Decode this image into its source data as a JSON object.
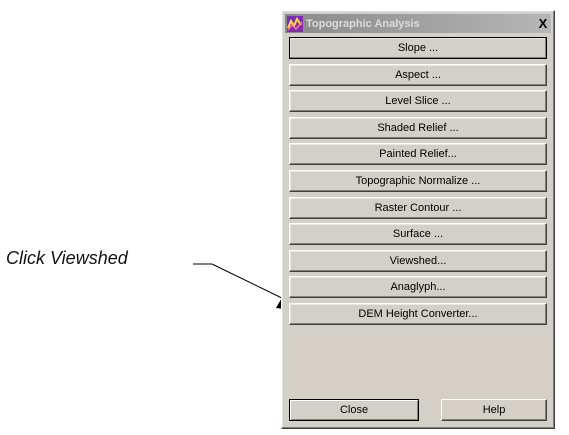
{
  "callout": {
    "text": "Click Viewshed"
  },
  "window": {
    "title": "Topographic Analysis",
    "close_glyph": "X",
    "buttons": [
      "Slope ...",
      "Aspect ...",
      "Level Slice ...",
      "Shaded Relief ...",
      "Painted Relief...",
      "Topographic Normalize ...",
      "Raster Contour ...",
      "Surface ...",
      "Viewshed...",
      "Anaglyph...",
      "DEM Height Converter..."
    ],
    "close_label": "Close",
    "help_label": "Help"
  },
  "icons": {
    "app": "topographic-app-icon",
    "close": "close-icon"
  },
  "colors": {
    "face": "#d4d0c8",
    "titlebar": "#9a9a9a",
    "title_text": "#dcdcdc"
  }
}
